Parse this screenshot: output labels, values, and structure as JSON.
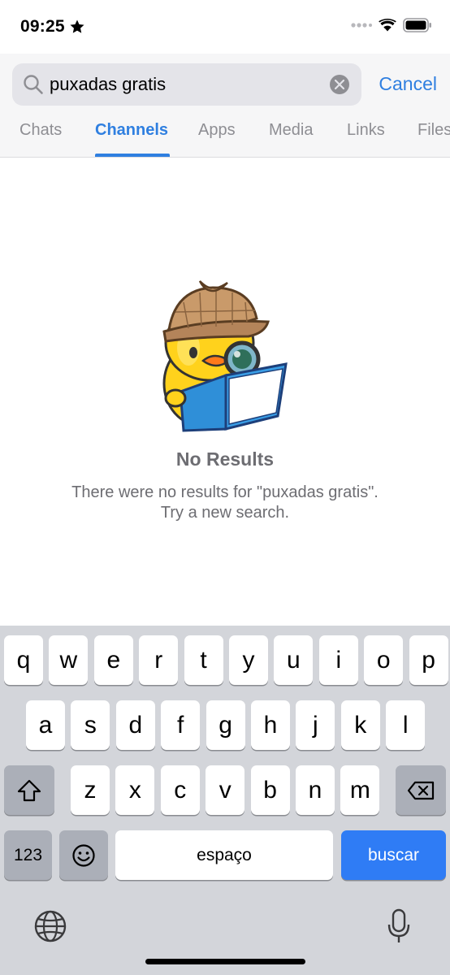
{
  "status_bar": {
    "time": "09:25",
    "icons": [
      "star-icon",
      "signal-dots-icon",
      "wifi-icon",
      "battery-icon"
    ]
  },
  "search": {
    "query": "puxadas gratis",
    "cancel_label": "Cancel",
    "icons": [
      "search-icon",
      "clear-icon"
    ]
  },
  "tabs": [
    {
      "label": "Chats"
    },
    {
      "label": "Channels",
      "active": true
    },
    {
      "label": "Apps"
    },
    {
      "label": "Media"
    },
    {
      "label": "Links"
    },
    {
      "label": "Files"
    }
  ],
  "empty_state": {
    "sticker": "duck-detective-reading-sticker",
    "title": "No Results",
    "line1": "There were no results for \"puxadas gratis\".",
    "line2": "Try a new search."
  },
  "keyboard": {
    "row1": [
      "q",
      "w",
      "e",
      "r",
      "t",
      "y",
      "u",
      "i",
      "o",
      "p"
    ],
    "row2": [
      "a",
      "s",
      "d",
      "f",
      "g",
      "h",
      "j",
      "k",
      "l"
    ],
    "row3": [
      "z",
      "x",
      "c",
      "v",
      "b",
      "n",
      "m"
    ],
    "numbers_label": "123",
    "space_label": "espaço",
    "return_label": "buscar",
    "icons": [
      "shift-icon",
      "backspace-icon",
      "emoji-icon",
      "globe-icon",
      "microphone-icon"
    ]
  },
  "colors": {
    "accent": "#2f7fe0",
    "keyboard_bg": "#d3d5da",
    "return_key": "#2f7cf5"
  }
}
